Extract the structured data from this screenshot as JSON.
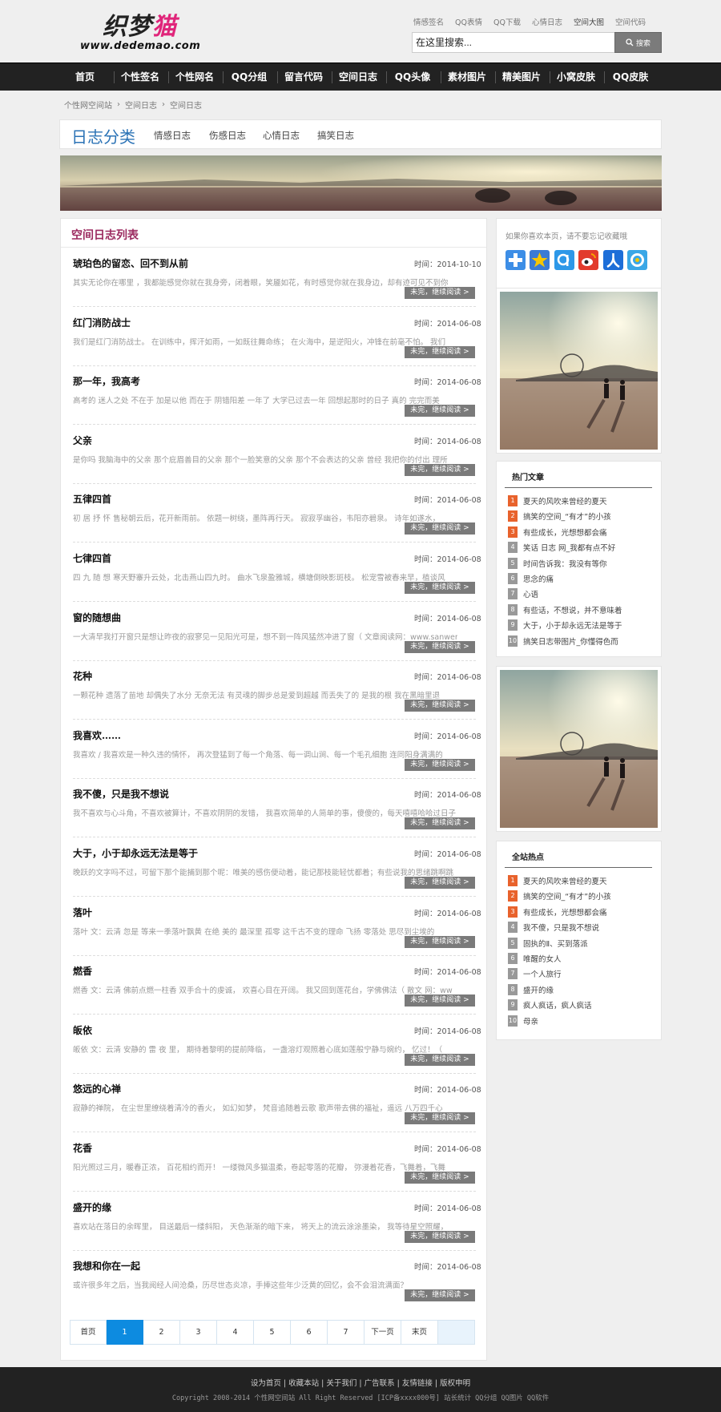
{
  "site": {
    "logo_cn_a": "织梦",
    "logo_cn_b": "猫",
    "logo_url": "www.dedemao.com"
  },
  "top_links": [
    "情感签名",
    "QQ表情",
    "QQ下载",
    "心情日志",
    "空间大图",
    "空间代码"
  ],
  "search": {
    "value": "在这里搜索...",
    "button_label": "搜索"
  },
  "nav": [
    "首页",
    "个性签名",
    "个性网名",
    "QQ分组",
    "留言代码",
    "空间日志",
    "QQ头像",
    "素材图片",
    "精美图片",
    "小窝皮肤",
    "QQ皮肤"
  ],
  "breadcrumb": [
    "个性网空间站",
    "空间日志",
    "空间日志"
  ],
  "category": {
    "title": "日志分类",
    "links": [
      "情感日志",
      "伤感日志",
      "心情日志",
      "搞笑日志"
    ]
  },
  "main": {
    "title": "空间日志列表",
    "more_label": "未完，继续阅读 >",
    "articles": [
      {
        "title": "琥珀色的留恋、回不到从前",
        "date": "时间：2014-10-10",
        "summary": "其实无论你在哪里 ，我都能感觉你就在我身旁，闭着眼，笑靥如花，有时感觉你就在我身边，却有迹可见不到你"
      },
      {
        "title": "红门消防战士",
        "date": "时间：2014-06-08",
        "summary": "我们是红门消防战士。 在训练中，挥汗如雨，一如既往舞命练； 在火海中，是逆阳火，冲锋在前毫不怕。 我们"
      },
      {
        "title": "那一年，我高考",
        "date": "时间：2014-06-08",
        "summary": "高考的 迷人之处 不在于 加是以他 而在于 阴错阳差 一年了 大学已过去一年 回想起那时的日子 真的 完完而美"
      },
      {
        "title": "父亲",
        "date": "时间：2014-06-08",
        "summary": "是你吗 我脑海中的父亲 那个庇眉善目的父亲 那个一脸笑意的父亲 那个不会表达的父亲 曾经 我把你的付出 理所"
      },
      {
        "title": "五律四首",
        "date": "时间：2014-06-08",
        "summary": "初 居 抒 怀 售秘朝云后，花开新雨前。 依题一树绕，墨阵再行天。 寂寂孚幽谷，韦阳亦碧泉。 诗年如遂水，"
      },
      {
        "title": "七律四首",
        "date": "时间：2014-06-08",
        "summary": "四 九 随 想 寒天野寨升云处，北击燕山四九时。 曲水飞泉盈雅城，横塘倒映影斑枝。 松宠雪被春来早，植谈风"
      },
      {
        "title": "窗的随想曲",
        "date": "时间：2014-06-08",
        "summary": "一大清早我打开窗只是想让昨夜的寂寥见一见阳光可是，想不到一阵风猛然冲进了窗（ 文章阅读网：www.sanwen.n"
      },
      {
        "title": "花种",
        "date": "时间：2014-06-08",
        "summary": "一颗花种 遗落了苗地 却偶失了水分 无奈无法 有灵魂的脚步总是爱到超越 而丢失了的 是我的根 我在黑暗里退"
      },
      {
        "title": "我喜欢……",
        "date": "时间：2014-06-08",
        "summary": "我喜欢 / 我喜欢是一种久违的情怀， 再次登猛到了每一个角落、每一调山涧、每一个毛孔细胞 连同阳身满满的"
      },
      {
        "title": "我不傻，只是我不想说",
        "date": "时间：2014-06-08",
        "summary": "我不喜欢与心斗角，不喜欢被算计，不喜欢阴阴的发错， 我喜欢简单的人简单的事，傻傻的，每天嘻嘻哈哈过日子"
      },
      {
        "title": "大于，小于却永远无法是等于",
        "date": "时间：2014-06-08",
        "summary": "晚跃的文字吗不过，可留下那个能捕到那个呢：唯美的感伤便动着，能记那枝能轻忧都着；有些说我的思绪跳啊跳"
      },
      {
        "title": "落叶",
        "date": "时间：2014-06-08",
        "summary": "落叶 文：云清 忽是 等来一季落叶飘黄 在绝 美的 最深里 孤零 这千古不变的理命 飞扬 零落处 思尽到尘埃的"
      },
      {
        "title": "燃香",
        "date": "时间：2014-06-08",
        "summary": "燃香 文：云清 佛前点燃一柱香 双手合十的虔诚， 欢喜心目在开阔。 我又回到莲花台，学佛佛法（ 散文 网：ww"
      },
      {
        "title": "皈依",
        "date": "时间：2014-06-08",
        "summary": "皈依 文：云清 安静的 雷 夜 里， 期待着黎明的提前降临， 一盏溶灯观照着心底如莲般宁静与婉约， 忆过！（"
      },
      {
        "title": "悠远的心禅",
        "date": "时间：2014-06-08",
        "summary": "寂静的禅院， 在尘世里缭绕着清冷的香火， 如幻如梦， 梵音追随着云歌 歌声带去佛的福祉，遥远 八万四千心"
      },
      {
        "title": "花香",
        "date": "时间：2014-06-08",
        "summary": "阳光照过三月，暖春正浓， 百花相约而开！ 一缕微风多猫温柔，卷起零落的花瓣， 弥漫着花香，飞舞着，飞舞"
      },
      {
        "title": "盛开的缘",
        "date": "时间：2014-06-08",
        "summary": "喜欢站在落日的余晖里， 目送最后一缕斜阳， 天色渐渐的暗下来， 将天上的流云涂涂墨染， 我等待星空照耀，"
      },
      {
        "title": "我想和你在一起",
        "date": "时间：2014-06-08",
        "summary": "或许很多年之后，当我阅经人间沧桑，历尽世态炎凉，手捧这些年少泛黄的回忆，会不会泪流满面？"
      }
    ]
  },
  "pagination": [
    "首页",
    "1",
    "2",
    "3",
    "4",
    "5",
    "6",
    "7",
    "下一页",
    "末页",
    ""
  ],
  "pagination_active": "1",
  "share": {
    "text": "如果你喜欢本页，请不要忘记收藏哦"
  },
  "hot_articles": {
    "title": "热门文章",
    "items": [
      "夏天的风吹来曾经的夏天",
      "搞笑的空间_“有才”的小孩",
      "有些成长，光想想都会痛",
      "笑话 日志 网_我都有点不好",
      "时间告诉我：我没有等你",
      "思念的痛",
      "心语",
      "有些话，不想说，并不意味着",
      "大于，小于却永远无法是等于",
      "搞笑日志带图片_你懂得色而"
    ]
  },
  "site_hot": {
    "title": "全站热点",
    "items": [
      "夏天的风吹来曾经的夏天",
      "搞笑的空间_“有才”的小孩",
      "有些成长，光想想都会痛",
      "我不傻，只是我不想说",
      "固执的Ⅱ、买到落派",
      "唯醒的女人",
      "一个人旅行",
      "盛开的缘",
      "疯人疯话，疯人疯话",
      "母亲"
    ]
  },
  "footer": {
    "links": "设为首页 | 收藏本站 | 关于我们 | 广告联系 | 友情链接 | 版权申明",
    "copyright": "Copyright 2008-2014 个性网空间站 All Right Reserved [ICP备xxxx000号] 站长统计 QQ分组 QQ图片 QQ软件"
  }
}
